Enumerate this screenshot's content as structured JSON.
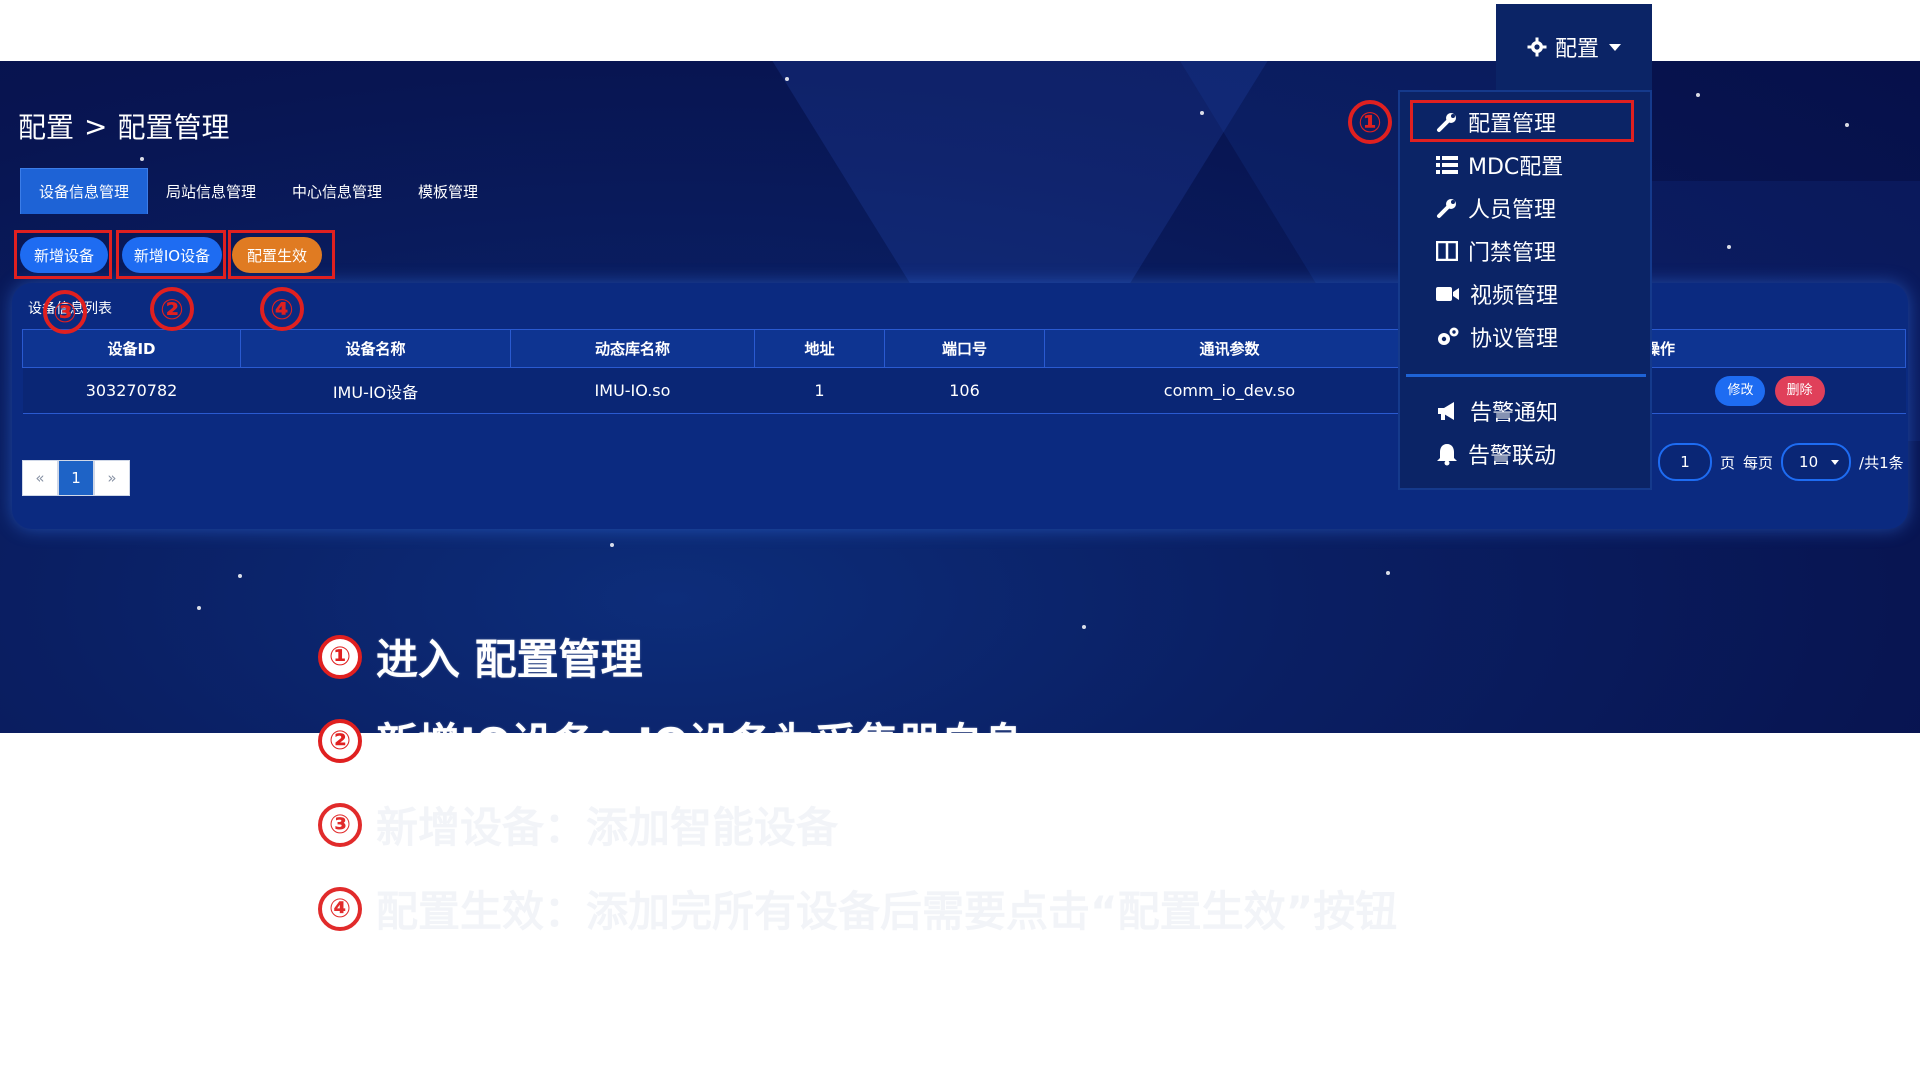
{
  "top_menu": {
    "label": "配置"
  },
  "breadcrumb": {
    "parent": "配置",
    "separator": ">",
    "current": "配置管理"
  },
  "tabs": [
    {
      "label": "设备信息管理",
      "active": true
    },
    {
      "label": "局站信息管理",
      "active": false
    },
    {
      "label": "中心信息管理",
      "active": false
    },
    {
      "label": "模板管理",
      "active": false
    }
  ],
  "actions": {
    "add_device": "新增设备",
    "add_io_device": "新增IO设备",
    "apply_config": "配置生效"
  },
  "card": {
    "title": "设备信息列表"
  },
  "table": {
    "headers": [
      "设备ID",
      "设备名称",
      "动态库名称",
      "地址",
      "端口号",
      "通讯参数",
      "操作"
    ],
    "rows": [
      {
        "id": "303270782",
        "name": "IMU-IO设备",
        "lib": "IMU-IO.so",
        "address": "1",
        "port": "106",
        "params": "comm_io_dev.so",
        "edit": "修改",
        "delete": "删除"
      }
    ]
  },
  "pagination": {
    "prev": "«",
    "current": "1",
    "next": "»",
    "page_input": "1",
    "page_label": "页",
    "per_page_label": "每页",
    "per_page": "10",
    "total": "/共1条"
  },
  "dropdown_menu": {
    "items": [
      {
        "label": "配置管理",
        "icon": "wrench-icon"
      },
      {
        "label": "MDC配置",
        "icon": "list-icon"
      },
      {
        "label": "人员管理",
        "icon": "wrench-icon"
      },
      {
        "label": "门禁管理",
        "icon": "door-icon"
      },
      {
        "label": "视频管理",
        "icon": "video-icon"
      },
      {
        "label": "协议管理",
        "icon": "gears-icon"
      },
      {
        "label": "告警通知",
        "icon": "megaphone-icon"
      },
      {
        "label": "告警联动",
        "icon": "bell-icon"
      }
    ]
  },
  "annotations": {
    "markers": [
      "①",
      "②",
      "③",
      "④"
    ]
  },
  "instructions": [
    {
      "num": "①",
      "text": "进入 配置管理"
    },
    {
      "num": "②",
      "text": "新增IO设备：IO设备为采集器自身"
    },
    {
      "num": "③",
      "text": "新增设备：添加智能设备"
    },
    {
      "num": "④",
      "text": "配置生效：添加完所有设备后需要点击“配置生效”按钮"
    }
  ],
  "colors": {
    "primary": "#1e6cf2",
    "warning": "#e07b22",
    "danger": "#e0405a",
    "annotation": "#e02020",
    "banner": "#0a1f63"
  }
}
